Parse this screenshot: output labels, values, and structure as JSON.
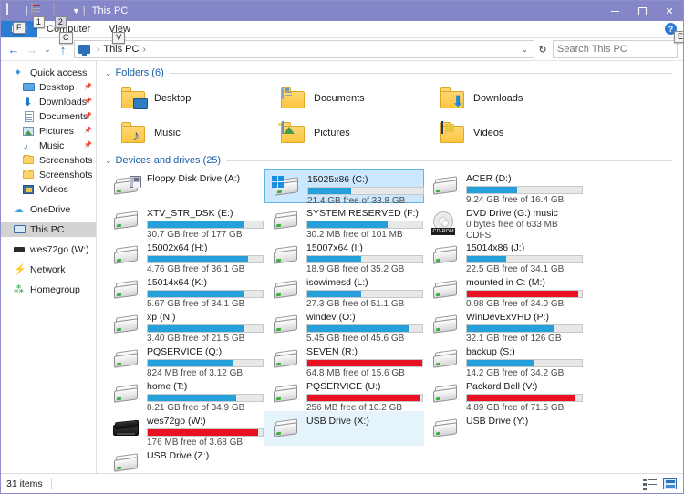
{
  "window": {
    "title": "This PC",
    "accent_color": "#8486c8",
    "quick_access_toolbar": [
      {
        "name": "properties",
        "keytip": "1"
      },
      {
        "name": "new-folder",
        "keytip": "2"
      }
    ],
    "controls": {
      "minimize": "–",
      "maximize": "□",
      "close": "✕"
    }
  },
  "ribbon": {
    "file_tab": {
      "label": "File",
      "keytip": "F"
    },
    "tabs": [
      {
        "label": "Computer",
        "keytip": "C"
      },
      {
        "label": "View",
        "keytip": "V"
      }
    ],
    "help": {
      "label": "?",
      "keytip": "E"
    }
  },
  "address_bar": {
    "back": "←",
    "forward": "→",
    "recent": "⌄",
    "up": "↑",
    "crumb": "This PC",
    "crumb_sep": "›",
    "dropdown": "⌄",
    "refresh": "↻"
  },
  "search": {
    "placeholder": "Search This PC",
    "value": ""
  },
  "sidebar": {
    "items": [
      {
        "label": "Quick access",
        "icon": "star-icon",
        "level": 0,
        "pinned": false,
        "selected": false
      },
      {
        "label": "Desktop",
        "icon": "desktop-icon",
        "level": 1,
        "pinned": true,
        "selected": false
      },
      {
        "label": "Downloads",
        "icon": "download-icon",
        "level": 1,
        "pinned": true,
        "selected": false
      },
      {
        "label": "Documents",
        "icon": "document-icon",
        "level": 1,
        "pinned": true,
        "selected": false
      },
      {
        "label": "Pictures",
        "icon": "picture-icon",
        "level": 1,
        "pinned": true,
        "selected": false
      },
      {
        "label": "Music",
        "icon": "music-icon",
        "level": 1,
        "pinned": true,
        "selected": false
      },
      {
        "label": "Screenshots",
        "icon": "folder-icon",
        "level": 1,
        "pinned": false,
        "selected": false
      },
      {
        "label": "Screenshots",
        "icon": "folder-icon",
        "level": 1,
        "pinned": false,
        "selected": false
      },
      {
        "label": "Videos",
        "icon": "video-icon",
        "level": 1,
        "pinned": false,
        "selected": false
      },
      {
        "label": "OneDrive",
        "icon": "cloud-icon",
        "level": 0,
        "pinned": false,
        "selected": false
      },
      {
        "label": "This PC",
        "icon": "pc-icon",
        "level": 0,
        "pinned": false,
        "selected": true
      },
      {
        "label": "wes72go (W:)",
        "icon": "usb-icon",
        "level": 0,
        "pinned": false,
        "selected": false
      },
      {
        "label": "Network",
        "icon": "network-icon",
        "level": 0,
        "pinned": false,
        "selected": false
      },
      {
        "label": "Homegroup",
        "icon": "homegroup-icon",
        "level": 0,
        "pinned": false,
        "selected": false
      }
    ]
  },
  "content": {
    "folders_group": {
      "caret": "⌄",
      "label": "Folders (6)",
      "items": [
        {
          "label": "Desktop",
          "overlay": "desktop-overlay-icon"
        },
        {
          "label": "Documents",
          "overlay": "document-overlay-icon"
        },
        {
          "label": "Downloads",
          "overlay": "download-overlay-icon"
        },
        {
          "label": "Music",
          "overlay": "music-overlay-icon"
        },
        {
          "label": "Pictures",
          "overlay": "picture-overlay-icon"
        },
        {
          "label": "Videos",
          "overlay": "video-overlay-icon"
        }
      ]
    },
    "drives_group": {
      "caret": "⌄",
      "label": "Devices and drives (25)",
      "items": [
        {
          "name": "Floppy Disk Drive (A:)",
          "icon": "floppy-drive-icon",
          "bar": false,
          "free": "",
          "percent": 0,
          "red": false,
          "state": "normal"
        },
        {
          "name": "15025x86 (C:)",
          "icon": "windows-drive-icon",
          "bar": true,
          "free": "21.4 GB free of 33.8 GB",
          "percent": 37,
          "red": false,
          "state": "selected"
        },
        {
          "name": "ACER (D:)",
          "icon": "hard-drive-icon",
          "bar": true,
          "free": "9.24 GB free of 16.4 GB",
          "percent": 44,
          "red": false,
          "state": "normal"
        },
        {
          "name": "XTV_STR_DSK (E:)",
          "icon": "hard-drive-icon",
          "bar": true,
          "free": "30.7 GB free of 177 GB",
          "percent": 83,
          "red": false,
          "state": "normal"
        },
        {
          "name": "SYSTEM RESERVED (F:)",
          "icon": "hard-drive-icon",
          "bar": true,
          "free": "30.2 MB free of 101 MB",
          "percent": 70,
          "red": false,
          "state": "normal"
        },
        {
          "name": "DVD Drive (G:) music",
          "icon": "cd-drive-icon",
          "bar": false,
          "free": "0 bytes free of 633 MB",
          "fs": "CDFS",
          "percent": 0,
          "red": false,
          "state": "normal"
        },
        {
          "name": "15002x64 (H:)",
          "icon": "hard-drive-icon",
          "bar": true,
          "free": "4.76 GB free of 36.1 GB",
          "percent": 87,
          "red": false,
          "state": "normal"
        },
        {
          "name": "15007x64 (I:)",
          "icon": "hard-drive-icon",
          "bar": true,
          "free": "18.9 GB free of 35.2 GB",
          "percent": 47,
          "red": false,
          "state": "normal"
        },
        {
          "name": "15014x86 (J:)",
          "icon": "hard-drive-icon",
          "bar": true,
          "free": "22.5 GB free of 34.1 GB",
          "percent": 34,
          "red": false,
          "state": "normal"
        },
        {
          "name": "15014x64 (K:)",
          "icon": "hard-drive-icon",
          "bar": true,
          "free": "5.67 GB free of 34.1 GB",
          "percent": 83,
          "red": false,
          "state": "normal"
        },
        {
          "name": "isowimesd (L:)",
          "icon": "hard-drive-icon",
          "bar": true,
          "free": "27.3 GB free of 51.1 GB",
          "percent": 47,
          "red": false,
          "state": "normal"
        },
        {
          "name": "mounted in C: (M:)",
          "icon": "hard-drive-icon",
          "bar": true,
          "free": "0.98 GB free of 34.0 GB",
          "percent": 97,
          "red": true,
          "state": "normal"
        },
        {
          "name": "xp (N:)",
          "icon": "hard-drive-icon",
          "bar": true,
          "free": "3.40 GB free of 21.5 GB",
          "percent": 84,
          "red": false,
          "state": "normal"
        },
        {
          "name": "windev (O:)",
          "icon": "hard-drive-icon",
          "bar": true,
          "free": "5.45 GB free of 45.6 GB",
          "percent": 88,
          "red": false,
          "state": "normal"
        },
        {
          "name": "WinDevExVHD (P:)",
          "icon": "hard-drive-icon",
          "bar": true,
          "free": "32.1 GB free of 126 GB",
          "percent": 75,
          "red": false,
          "state": "normal"
        },
        {
          "name": "PQSERVICE (Q:)",
          "icon": "hard-drive-icon",
          "bar": true,
          "free": "824 MB free of 3.12 GB",
          "percent": 74,
          "red": false,
          "state": "normal"
        },
        {
          "name": "SEVEN (R:)",
          "icon": "hard-drive-icon",
          "bar": true,
          "free": "64.8 MB free of 15.6 GB",
          "percent": 100,
          "red": true,
          "state": "normal"
        },
        {
          "name": "backup (S:)",
          "icon": "hard-drive-icon",
          "bar": true,
          "free": "14.2 GB free of 34.2 GB",
          "percent": 59,
          "red": false,
          "state": "normal"
        },
        {
          "name": "home (T:)",
          "icon": "hard-drive-icon",
          "bar": true,
          "free": "8.21 GB free of 34.9 GB",
          "percent": 77,
          "red": false,
          "state": "normal"
        },
        {
          "name": "PQSERVICE (U:)",
          "icon": "hard-drive-icon",
          "bar": true,
          "free": "256 MB free of 10.2 GB",
          "percent": 98,
          "red": true,
          "state": "normal"
        },
        {
          "name": "Packard Bell (V:)",
          "icon": "hard-drive-icon",
          "bar": true,
          "free": "4.89 GB free of 71.5 GB",
          "percent": 94,
          "red": true,
          "state": "normal"
        },
        {
          "name": "wes72go (W:)",
          "icon": "external-drive-icon",
          "bar": true,
          "free": "176 MB free of 3.68 GB",
          "percent": 96,
          "red": true,
          "state": "normal"
        },
        {
          "name": "USB Drive (X:)",
          "icon": "hard-drive-icon",
          "bar": false,
          "free": "",
          "percent": 0,
          "red": false,
          "state": "hover"
        },
        {
          "name": "USB Drive (Y:)",
          "icon": "hard-drive-icon",
          "bar": false,
          "free": "",
          "percent": 0,
          "red": false,
          "state": "normal"
        },
        {
          "name": "USB Drive (Z:)",
          "icon": "hard-drive-icon",
          "bar": false,
          "free": "",
          "percent": 0,
          "red": false,
          "state": "normal"
        }
      ]
    }
  },
  "statusbar": {
    "item_count": "31 items",
    "views": [
      {
        "name": "details-view-button"
      },
      {
        "name": "large-icons-view-button"
      }
    ]
  }
}
